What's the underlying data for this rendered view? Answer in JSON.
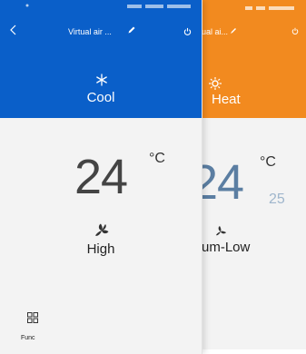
{
  "back_card": {
    "title": "ual ai...",
    "mode_label": "Heat",
    "temperature": "24",
    "unit": "°C",
    "set_temperature": "25",
    "fan_speed": "um-Low",
    "header_color": "#f28a1f"
  },
  "front_card": {
    "title": "Virtual air ...",
    "mode_label": "Cool",
    "temperature": "24",
    "unit": "°C",
    "fan_speed": "High",
    "func_label": "Func",
    "header_color": "#0a5fc9"
  },
  "icons": {
    "back": "chevron-left",
    "edit": "pencil",
    "power": "power",
    "mode_cool": "snowflake",
    "mode_heat": "sun",
    "fan": "fan",
    "func": "grid"
  }
}
